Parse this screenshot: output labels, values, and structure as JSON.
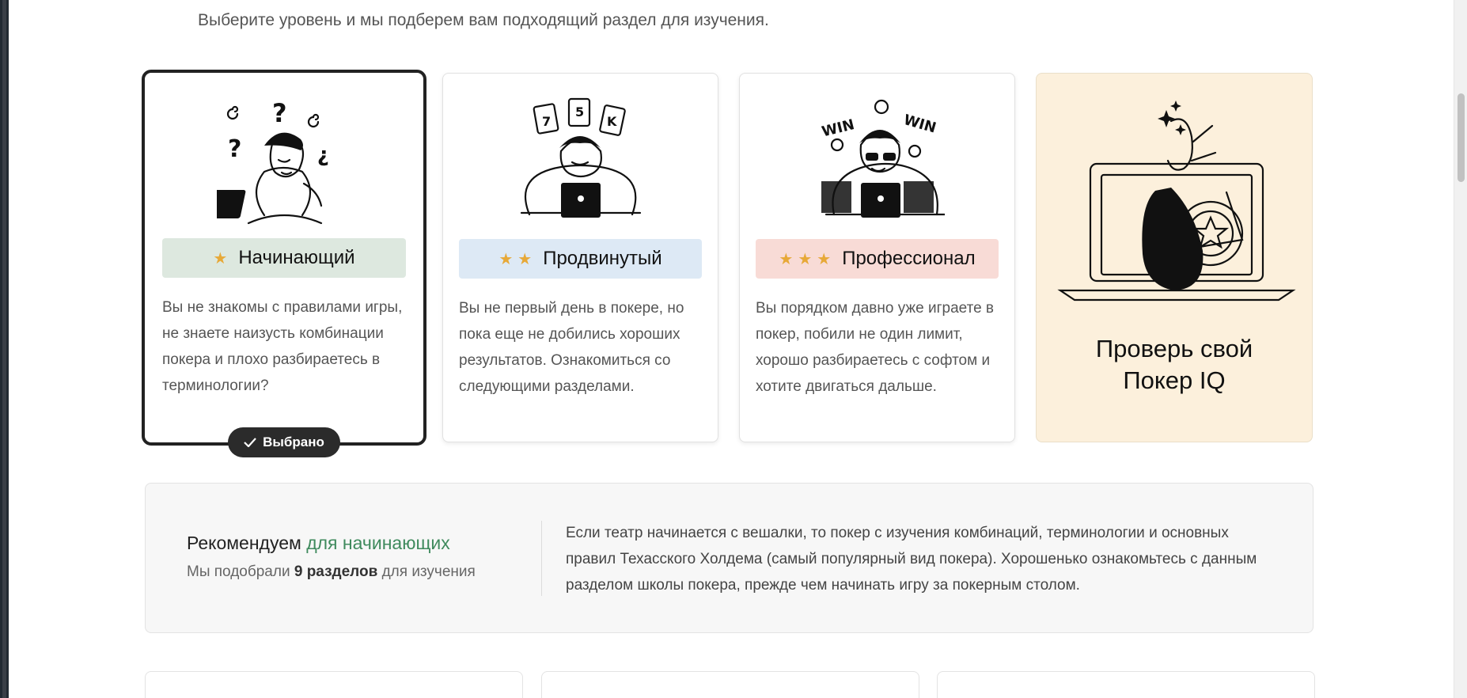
{
  "subtitle": "Выберите уровень и мы подберем вам подходящий раздел для изучения.",
  "levels": [
    {
      "stars": "★",
      "label": "Начинающий",
      "pill_color": "#dde8df",
      "description": "Вы не знакомы с правилами игры, не знаете наизусть комбинации покера и плохо разбираетесь в терминологии?",
      "selected": true
    },
    {
      "stars": "★★",
      "label": "Продвинутый",
      "pill_color": "#dde9f5",
      "description": "Вы не первый день в покере, но пока еще не добились хороших результатов. Ознакомиться со следующими разделами.",
      "selected": false
    },
    {
      "stars": "★★★",
      "label": "Профессионал",
      "pill_color": "#f8dbd6",
      "description": "Вы порядком давно уже играете в покер, побили не один лимит, хорошо разбираетесь с софтом и хотите двигаться дальше.",
      "selected": false
    }
  ],
  "selected_badge": {
    "icon": "check-icon",
    "label": "Выбрано"
  },
  "promo": {
    "title_line1": "Проверь свой",
    "title_line2": "Покер IQ",
    "background": "#fcf0dc"
  },
  "recommendation": {
    "heading_prefix": "Рекомендуем",
    "heading_accent": "для начинающих",
    "sub_prefix": "Мы подобрали",
    "sub_bold": "9 разделов",
    "sub_suffix": "для изучения",
    "text": "Если театр начинается с вешалки, то покер с изучения комбинаций, терминологии и основных правил Техасского Холдема (самый популярный вид покера). Хорошенько ознакомьтесь с данным разделом школы покера, прежде чем начинать игру за покерным столом.",
    "accent_color": "#3f8a5d"
  },
  "illustrations": [
    "confused-player-illustration",
    "cards-player-illustration",
    "winning-player-illustration",
    "poker-iq-illustration"
  ]
}
